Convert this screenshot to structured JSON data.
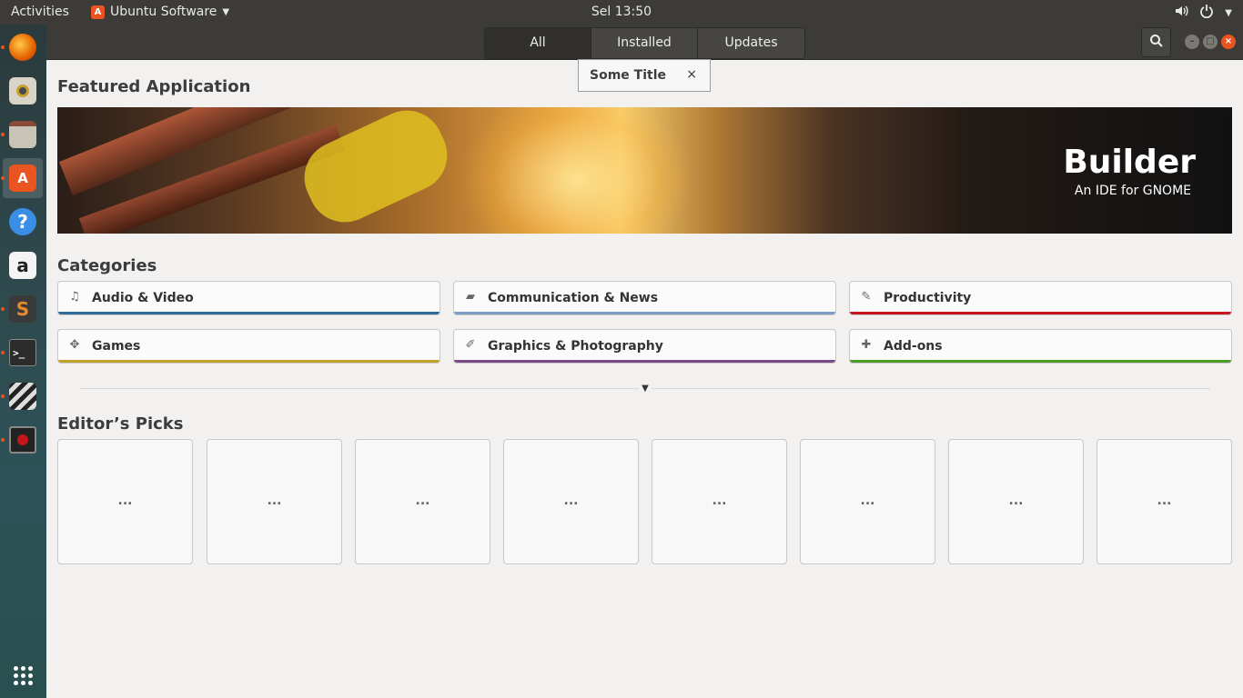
{
  "topbar": {
    "activities": "Activities",
    "app_name": "Ubuntu Software",
    "clock": "Sel 13:50",
    "icons": [
      "volume-icon",
      "power-icon",
      "chevron-down-icon"
    ]
  },
  "dock": {
    "items": [
      {
        "name": "firefox",
        "icon": "firefox-icon",
        "color": "#e66000"
      },
      {
        "name": "rhythmbox",
        "icon": "speaker-icon",
        "color": "#d8d4c8"
      },
      {
        "name": "files",
        "icon": "file-cabinet-icon",
        "color": "#c9c4b8"
      },
      {
        "name": "ubuntu-software",
        "icon": "software-bag-icon",
        "color": "#e95420"
      },
      {
        "name": "help",
        "icon": "help-icon",
        "color": "#3a8ee6"
      },
      {
        "name": "amazon",
        "icon": "amazon-icon",
        "color": "#f4f4f4"
      },
      {
        "name": "sublime-text",
        "icon": "sublime-icon",
        "color": "#e8892a"
      },
      {
        "name": "terminal",
        "icon": "terminal-icon",
        "color": "#2c2c2c"
      },
      {
        "name": "video-editor",
        "icon": "clapperboard-icon",
        "color": "#444444"
      },
      {
        "name": "screen-recorder",
        "icon": "recorder-icon",
        "color": "#6a2a2a"
      }
    ],
    "show_apps_icon": "grid-icon"
  },
  "header": {
    "tabs": [
      {
        "label": "All",
        "active": true
      },
      {
        "label": "Installed",
        "active": false
      },
      {
        "label": "Updates",
        "active": false
      }
    ],
    "search_icon": "search-icon"
  },
  "popover": {
    "title": "Some Title",
    "close": "×"
  },
  "featured": {
    "heading": "Featured Application",
    "app_title": "Builder",
    "app_subtitle": "An IDE for GNOME"
  },
  "categories": {
    "heading": "Categories",
    "items": [
      {
        "label": "Audio & Video",
        "icon": "music-note-icon",
        "color": "#2e6b9e"
      },
      {
        "label": "Communication & News",
        "icon": "chat-bubble-icon",
        "color": "#7b9dc6"
      },
      {
        "label": "Productivity",
        "icon": "edit-icon",
        "color": "#c4161c"
      },
      {
        "label": "Games",
        "icon": "gamepad-icon",
        "color": "#c0a228"
      },
      {
        "label": "Graphics & Photography",
        "icon": "brush-icon",
        "color": "#7a4a8a"
      },
      {
        "label": "Add-ons",
        "icon": "puzzle-icon",
        "color": "#4e9a26"
      }
    ]
  },
  "editors_picks": {
    "heading": "Editor’s Picks",
    "items": [
      "...",
      "...",
      "...",
      "...",
      "...",
      "...",
      "...",
      "..."
    ]
  }
}
